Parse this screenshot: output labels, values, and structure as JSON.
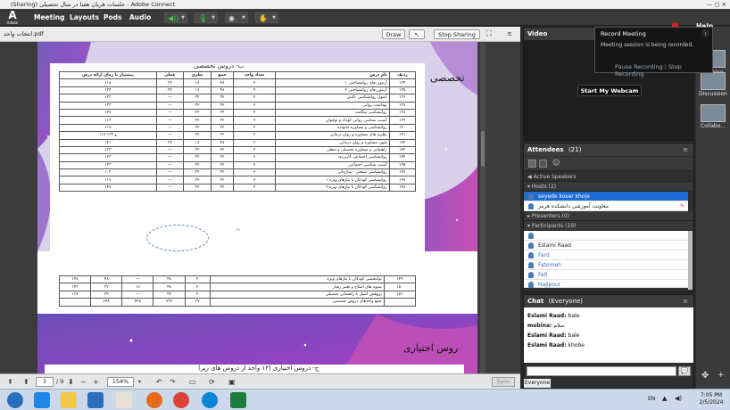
{
  "window": {
    "title": "(Sharing) جلسات هریان هفتا در سال تحصیلی - Adobe Connect"
  },
  "menubar": {
    "logo_text": "A",
    "logo_sub": "Adobe",
    "items": [
      "Meeting",
      "Layouts",
      "Pods",
      "Audio"
    ],
    "help": "Help"
  },
  "share": {
    "filename": "انتخاب واحد.pdf",
    "draw": "Draw",
    "stop_sharing": "Stop Sharing",
    "page_current": "3",
    "page_total": "/ 9",
    "zoom": "154%",
    "sync": "Sync"
  },
  "document": {
    "section_title": "ب- دروس تخصصی",
    "side_title": "تخصصی",
    "footer_title": "روس اختیاری",
    "footer_sub": "ج- دروس اختیاری (۱۲ واحد از دروس های زیر)",
    "page_number": "۱۱",
    "headers": [
      "ردیف",
      "نام درس",
      "تعداد واحد",
      "جمع",
      "نظری",
      "عملی",
      "پیشنیاز یا زمان ارائه درس"
    ],
    "rows": [
      [
        "۱۳۴",
        "آزمون های روانشناختی ۱",
        "۲",
        "۴۸",
        "۱۶",
        "۳۲",
        "۱۱۸"
      ],
      [
        "۱۳۵",
        "آزمون های روانشناختی ۲",
        "۲",
        "۴۸",
        "۱۶",
        "۳۲",
        "۱۳۴"
      ],
      [
        "۱۳۶",
        "اصول روانشناسی بالینی",
        "۲",
        "۳۲",
        "۳۲",
        "—",
        "۱۳۳"
      ],
      [
        "۱۳۷",
        "بهداشت روانی",
        "۲",
        "۳۲",
        "۳۲",
        "—",
        "۱۳۳"
      ],
      [
        "۱۳۸",
        "روانشناسی سلامت",
        "۲",
        "۳۲",
        "۳۲",
        "—",
        "۱۲۷"
      ],
      [
        "۱۳۹",
        "آسیب شناسی روانی کودک و نوجوان",
        "۲",
        "۳۲",
        "۳۲",
        "—",
        "۱۱۳"
      ],
      [
        "۱۴۰",
        "روانشناسی و مشاوره خانواده",
        "۲",
        "۳۲",
        "۳۲",
        "—",
        "۱۱۷"
      ],
      [
        "۱۴۱",
        "نظریه های مشاوره و روان درمانی",
        "۲",
        "۳۲",
        "۳۲",
        "—",
        "۱۱۷ و ۱۳۳"
      ],
      [
        "۱۴۲",
        "فنون مشاوره و روان درمانی",
        "۲",
        "۴۸",
        "۱۶",
        "۳۲",
        "۱۴۱"
      ],
      [
        "۱۴۳",
        "راهنمایی و مشاوره تحصیلی و شغلی",
        "۲",
        "۳۲",
        "۳۲",
        "—",
        "۱۳۳"
      ],
      [
        "۱۴۴",
        "روانشناسی اجتماعی کاربردی",
        "۲",
        "۳۲",
        "۳۲",
        "—",
        "۱۲۳"
      ],
      [
        "۱۴۵",
        "آسیب شناسی اجتماعی",
        "۲",
        "۳۲",
        "۳۲",
        "—",
        "۱۳۳"
      ],
      [
        "۱۴۶",
        "روانشناسی صنعتی - سازمانی",
        "۲",
        "۳۲",
        "۳۲",
        "—",
        "۱۰۳"
      ],
      [
        "۱۴۷",
        "روانشناسی کودکان با نیازهای ویژه ۱",
        "۲",
        "۳۲",
        "۳۲",
        "—",
        "۱۱۷"
      ],
      [
        "۱۴۸",
        "روانشناسی کودکان با نیازهای ویژه ۲",
        "۲",
        "۳۲",
        "۳۲",
        "—",
        "۱۴۷"
      ]
    ],
    "rows2": [
      [
        "۱۴۹",
        "توانبخشی کودکان با نیازهای ویژه",
        "۲",
        "۴۸",
        "—",
        "۴۸",
        "۱۴۸"
      ],
      [
        "۱۵۰",
        "شیوه های اصلاح و تغییر رفتار",
        "۲",
        "۴۸",
        "۱۶",
        "۳۲",
        "۱۴۳"
      ],
      [
        "۱۵۱",
        "پژوهش اصیل با راهنمایی تحصیلی",
        "۲",
        "۳۲",
        "—",
        "۳۲",
        "۱۳۸"
      ],
      [
        "",
        "جمع واحدهای دروس تخصصی",
        "۳۷",
        "۷۳۶",
        "۴۴۸",
        "۲۸۸",
        ""
      ]
    ]
  },
  "video": {
    "title": "Video",
    "start_webcam": "Start My Webcam"
  },
  "record_popup": {
    "title": "Record Meeting",
    "status": "Meeting session is being recorded.",
    "pause": "Pause Recording",
    "stop": "Stop Recording"
  },
  "layouts": {
    "items": [
      "Sharing",
      "Discussion",
      "Collabo..."
    ]
  },
  "attendees": {
    "title": "Attendees",
    "count": "(21)",
    "active_speakers": "Active Speakers",
    "hosts_label": "Hosts (2)",
    "hosts": [
      "seyede kosar khoje",
      "معاونت آموزشی دانشکده هرمز"
    ],
    "presenters_label": "Presenters (0)",
    "participants_label": "Participants (19)",
    "participants": [
      "",
      "Eslami Raad",
      "Fard",
      "Fatemeh",
      "Fati",
      "Hajipour"
    ]
  },
  "chat": {
    "title": "Chat",
    "scope": "(Everyone)",
    "messages": [
      {
        "name": "Eslami Raad:",
        "text": "bale"
      },
      {
        "name": "mobina:",
        "text": "سلام"
      },
      {
        "name": "Eslami Raad:",
        "text": "bale"
      },
      {
        "name": "Eslami Raad:",
        "text": "khobe"
      }
    ],
    "tab": "Everyone"
  },
  "taskbar": {
    "lang": "EN",
    "time": "7:05 PM",
    "date": "2/5/2024"
  }
}
